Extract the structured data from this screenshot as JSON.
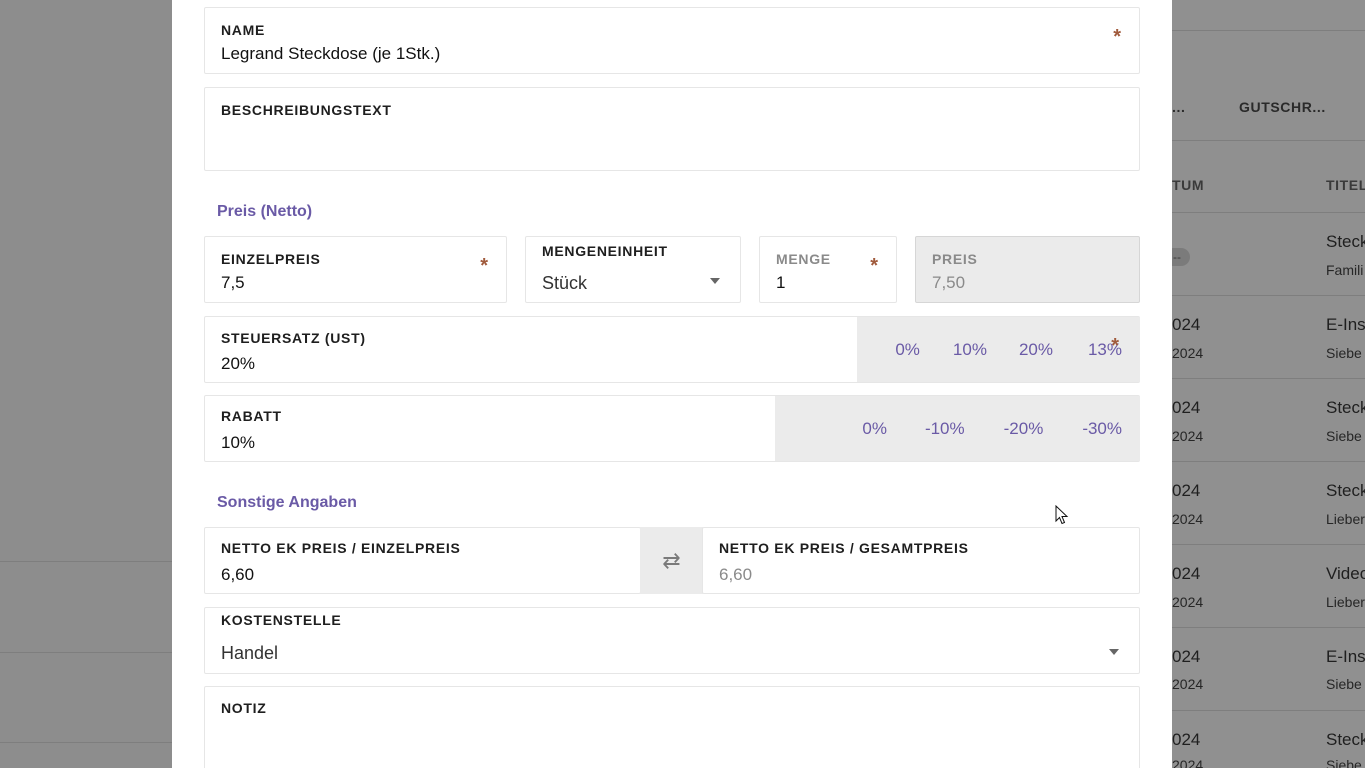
{
  "form": {
    "name": {
      "label": "NAME",
      "value": "Legrand Steckdose (je 1Stk.)"
    },
    "description": {
      "label": "BESCHREIBUNGSTEXT",
      "value": ""
    },
    "section_price": "Preis (Netto)",
    "unit_price": {
      "label": "EINZELPREIS",
      "value": "7,5"
    },
    "unit": {
      "label": "MENGENEINHEIT",
      "value": "Stück"
    },
    "quantity": {
      "label": "MENGE",
      "value": "1"
    },
    "price": {
      "label": "PREIS",
      "value": "7,50"
    },
    "tax": {
      "label": "STEUERSATZ (UST)",
      "value": "20%",
      "options": [
        "0%",
        "10%",
        "20%",
        "13%"
      ]
    },
    "discount": {
      "label": "RABATT",
      "value": "10%",
      "options": [
        "0%",
        "-10%",
        "-20%",
        "-30%"
      ]
    },
    "section_other": "Sonstige Angaben",
    "purchase_unit": {
      "label": "NETTO EK PREIS / EINZELPREIS",
      "value": "6,60"
    },
    "purchase_total": {
      "label": "NETTO EK PREIS / GESAMTPREIS",
      "value": "6,60"
    },
    "cost_center": {
      "label": "KOSTENSTELLE",
      "value": "Handel"
    },
    "note": {
      "label": "NOTIZ",
      "value": ""
    },
    "required_mark": "*"
  },
  "background": {
    "tabs": [
      "...",
      "GUTSCHR..."
    ],
    "columns": [
      "TUM",
      "TITEL"
    ],
    "rows": [
      {
        "date": "--",
        "date2": "",
        "title": "Steck",
        "sub": "Famili"
      },
      {
        "date": "024",
        "date2": "2024",
        "title": "E-Ins",
        "sub": "Siebe"
      },
      {
        "date": "024",
        "date2": "2024",
        "title": "Steck",
        "sub": "Siebe"
      },
      {
        "date": "024",
        "date2": "2024",
        "title": "Steck",
        "sub": "Lieber"
      },
      {
        "date": "024",
        "date2": "2024",
        "title": "Video",
        "sub": "Lieber"
      },
      {
        "date": "024",
        "date2": "2024",
        "title": "E-Ins",
        "sub": "Siebe"
      },
      {
        "date": "024",
        "date2": "2024",
        "title": "Steck",
        "sub": "Siebe"
      }
    ]
  }
}
